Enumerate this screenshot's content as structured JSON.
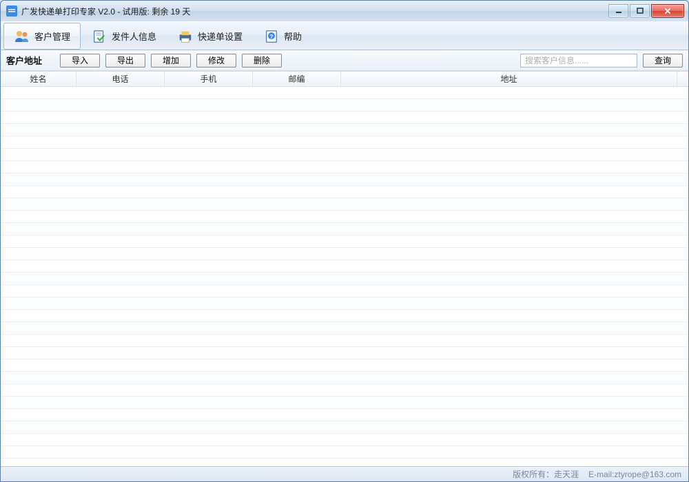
{
  "window": {
    "title": "广发快递单打印专家 V2.0 - 试用版: 剩余 19 天"
  },
  "toolbar": {
    "items": [
      {
        "label": "客户管理"
      },
      {
        "label": "发件人信息"
      },
      {
        "label": "快递单设置"
      },
      {
        "label": "帮助"
      }
    ]
  },
  "actionbar": {
    "section_label": "客户地址",
    "buttons": {
      "import": "导入",
      "export": "导出",
      "add": "增加",
      "edit": "修改",
      "delete": "删除",
      "search": "查询"
    },
    "search_placeholder": "搜索客户信息......"
  },
  "table": {
    "headers": {
      "name": "姓名",
      "tel": "电话",
      "mobile": "手机",
      "zip": "邮编",
      "addr": "地址"
    },
    "rows": []
  },
  "statusbar": {
    "copyright": "版权所有：走天涯",
    "email": "E-mail:ztyrope@163.com"
  }
}
